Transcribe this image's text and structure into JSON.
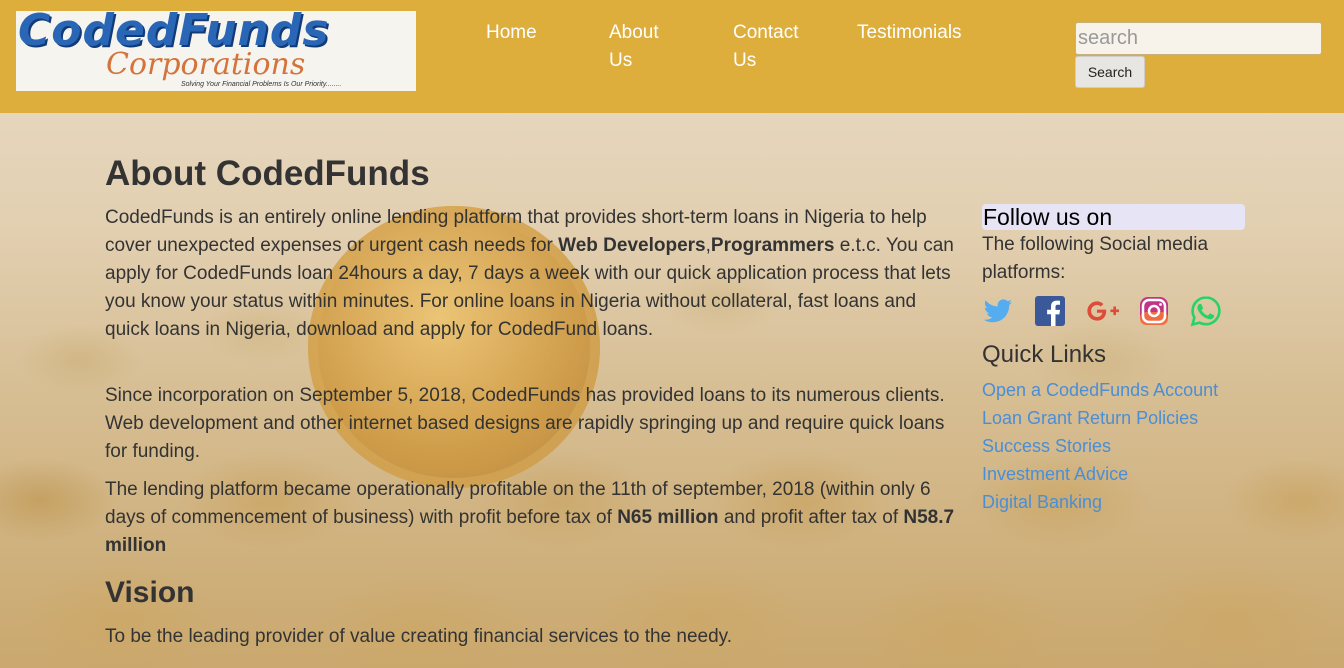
{
  "header": {
    "logo": {
      "line1": "CodedFunds",
      "line2": "Corporations",
      "tagline": "Solving Your Financial Problems Is Our Priority........"
    },
    "nav": [
      "Home",
      "About Us",
      "Contact Us",
      "Testimonials"
    ],
    "nav_lines": [
      [
        "Home"
      ],
      [
        "About",
        "Us"
      ],
      [
        "Contact",
        "Us"
      ],
      [
        "Testimonials"
      ]
    ],
    "search_placeholder": "search",
    "search_button": "Search"
  },
  "main": {
    "title": "About CodedFunds",
    "p1_a": "CodedFunds is an entirely online lending platform that provides short-term loans in Nigeria to help cover unexpected expenses or urgent cash needs for ",
    "p1_b1": "Web Developers",
    "p1_comma": ",",
    "p1_b2": "Programmers",
    "p1_c": " e.t.c. You can apply for CodedFunds loan 24hours a day, 7 days a week with our quick application process that lets you know your status within minutes. For online loans in Nigeria without collateral, fast loans and quick loans in Nigeria, download and apply for CodedFund loans.",
    "p2": "Since incorporation on September 5, 2018, CodedFunds has provided loans to its numerous clients. Web development and other internet based designs are rapidly springing up and require quick loans for funding.",
    "p3_a": "The lending platform became operationally profitable on the 11th of september, 2018 (within only 6 days of commencement of business) with profit before tax of ",
    "p3_b1": "N65 million",
    "p3_c": " and profit after tax of ",
    "p3_b2": "N58.7 million",
    "vision_title": "Vision",
    "vision_text": "To be the leading provider of value creating financial services to the needy."
  },
  "sidebar": {
    "follow_title": "Follow us on",
    "follow_text": "The following Social media platforms:",
    "social_icons": [
      "twitter-icon",
      "facebook-icon",
      "google-plus-icon",
      "instagram-icon",
      "whatsapp-icon"
    ],
    "quick_links_title": "Quick Links",
    "quick_links": [
      "Open a CodedFunds Account",
      "Loan Grant Return Policies",
      "Success Stories",
      "Investment Advice",
      "Digital Banking"
    ]
  },
  "colors": {
    "header_bg": "#deae3c",
    "link": "#4a8ed6",
    "twitter": "#55acee",
    "facebook": "#3b5998",
    "google_plus": "#dd4b39",
    "instagram": "#c13584",
    "whatsapp": "#25d366"
  }
}
